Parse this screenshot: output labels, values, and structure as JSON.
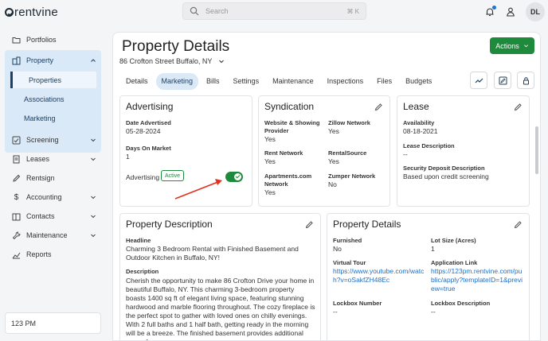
{
  "app": {
    "logo_text": "rentvine",
    "search_placeholder": "Search",
    "search_shortcut": "⌘ K",
    "user_initials": "DL"
  },
  "sidebar": {
    "items": [
      {
        "label": "Portfolios",
        "icon": "folder-icon"
      },
      {
        "label": "Property",
        "icon": "building-icon",
        "expanded": true
      },
      {
        "label": "Screening",
        "icon": "screening-icon"
      },
      {
        "label": "Leases",
        "icon": "leases-icon"
      },
      {
        "label": "Rentsign",
        "icon": "pen-icon"
      },
      {
        "label": "Accounting",
        "icon": "dollar-icon"
      },
      {
        "label": "Contacts",
        "icon": "contacts-icon"
      },
      {
        "label": "Maintenance",
        "icon": "wrench-icon"
      },
      {
        "label": "Reports",
        "icon": "chart-icon"
      }
    ],
    "property_subitems": [
      "Properties",
      "Associations",
      "Marketing"
    ],
    "clock": "123 PM"
  },
  "page": {
    "title": "Property Details",
    "address": "86 Crofton Street Buffalo, NY",
    "actions_label": "Actions",
    "tabs": [
      "Details",
      "Marketing",
      "Bills",
      "Settings",
      "Maintenance",
      "Inspections",
      "Files",
      "Budgets"
    ],
    "active_tab": "Marketing"
  },
  "advertising": {
    "title": "Advertising",
    "date_label": "Date Advertised",
    "date_value": "05-28-2024",
    "days_label": "Days On Market",
    "days_value": "1",
    "row_label": "Advertising",
    "badge": "Active",
    "enabled": true
  },
  "syndication": {
    "title": "Syndication",
    "fields": [
      {
        "label": "Website & Showing Provider",
        "value": "Yes"
      },
      {
        "label": "Zillow Network",
        "value": "Yes"
      },
      {
        "label": "Rent Network",
        "value": "Yes"
      },
      {
        "label": "RentalSource",
        "value": "Yes"
      },
      {
        "label": "Apartments.com Network",
        "value": "Yes"
      },
      {
        "label": "Zumper Network",
        "value": "No"
      }
    ]
  },
  "lease": {
    "title": "Lease",
    "availability_label": "Availability",
    "availability_value": "08-18-2021",
    "description_label": "Lease Description",
    "description_value": "--",
    "deposit_label": "Security Deposit Description",
    "deposit_value": "Based upon credit screening"
  },
  "property_description": {
    "title": "Property Description",
    "headline_label": "Headline",
    "headline_value": "Charming 3 Bedroom Rental with Finished Basement and Outdoor Kitchen in Buffalo, NY!",
    "description_label": "Description",
    "description_value": "Cherish the opportunity to make 86 Crofton Drive your home in beautiful Buffalo, NY. This charming 3-bedroom property boasts 1400 sq ft of elegant living space, featuring stunning hardwood and marble flooring throughout. The cozy fireplace is the perfect spot to gather with loved ones on chilly evenings. With 2 full baths and 1 half bath, getting ready in the morning will be a breeze. The finished basement provides additional space for"
  },
  "property_details_card": {
    "title": "Property Details",
    "furnished_label": "Furnished",
    "furnished_value": "No",
    "lot_label": "Lot Size (Acres)",
    "lot_value": "1",
    "tour_label": "Virtual Tour",
    "tour_value": "https://www.youtube.com/watch?v=oSakfZH48Ec",
    "app_link_label": "Application Link",
    "app_link_value": "https://123pm.rentvine.com/public/apply?templateID=1&preview=true",
    "lockbox_label": "Lockbox Number",
    "lockbox_value": "--",
    "lockbox_desc_label": "Lockbox Description",
    "lockbox_desc_value": "--"
  },
  "colors": {
    "accent_green": "#1e8a3c",
    "nav_highlight": "#d9e9f7",
    "link_blue": "#1e6fc4",
    "annotation_red": "#e0321f"
  }
}
